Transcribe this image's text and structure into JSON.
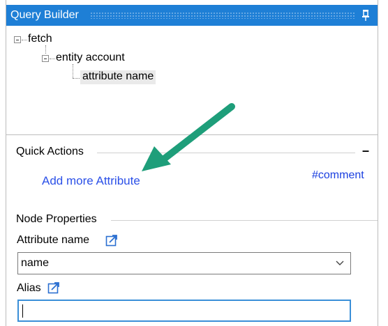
{
  "panel": {
    "title": "Query Builder"
  },
  "tree": {
    "nodes": [
      {
        "label": "fetch"
      },
      {
        "label": "entity account"
      },
      {
        "label": "attribute name"
      }
    ]
  },
  "quick_actions": {
    "title": "Quick Actions",
    "collapse_symbol": "–",
    "add_link": "Add more Attribute",
    "comment_link": "#comment"
  },
  "node_properties": {
    "title": "Node Properties",
    "attribute_name_label": "Attribute name",
    "attribute_name_value": "name",
    "alias_label": "Alias",
    "alias_value": ""
  },
  "colors": {
    "titlebar": "#1e7fd6",
    "link": "#2b50e8",
    "arrow": "#1e9e7a",
    "focus_border": "#3a8fd8"
  }
}
